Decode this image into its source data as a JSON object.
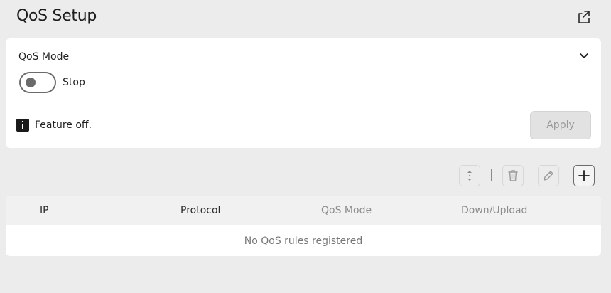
{
  "header": {
    "title": "QoS Setup",
    "export_icon": "export-icon"
  },
  "qos_mode": {
    "label": "QoS Mode",
    "toggle_state_label": "Stop",
    "toggle_on": false,
    "expand_icon": "chevron-down-icon"
  },
  "status": {
    "icon": "info-icon",
    "message": "Feature off.",
    "apply_label": "Apply",
    "apply_enabled": false
  },
  "toolbar": {
    "sort_icon": "sort-icon",
    "delete_icon": "trash-icon",
    "edit_icon": "pencil-icon",
    "add_icon": "plus-icon"
  },
  "table": {
    "columns": [
      "IP",
      "Protocol",
      "QoS Mode",
      "Down/Upload"
    ],
    "rows": [],
    "empty_message": "No QoS rules registered"
  },
  "colors": {
    "background": "#ececec",
    "card": "#ffffff",
    "disabled_text": "#9a9a9a"
  }
}
